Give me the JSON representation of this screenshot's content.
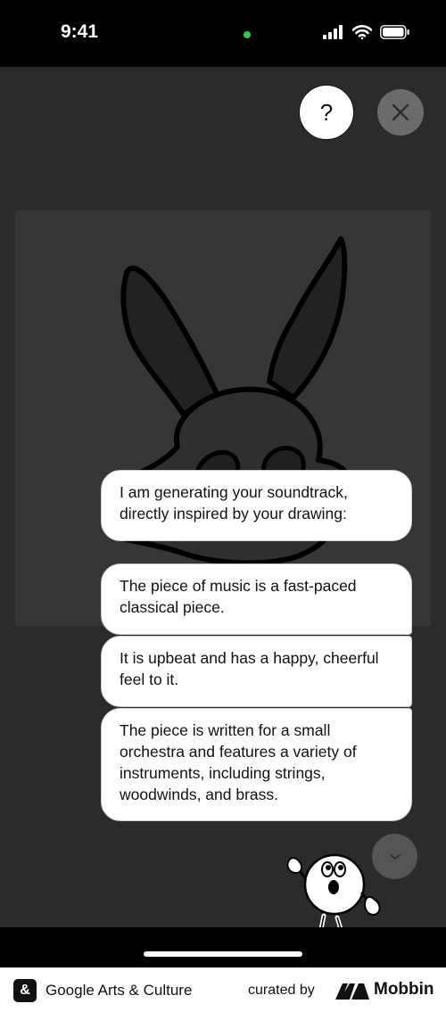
{
  "status_bar": {
    "time": "9:41",
    "camera_dot_color": "#2ecc40",
    "icons": [
      "cellular-signal-icon",
      "wifi-icon",
      "battery-icon"
    ]
  },
  "header": {
    "help_label": "?",
    "close_icon": "close-icon"
  },
  "messages": [
    {
      "text": "I am generating your soundtrack, directly inspired by your drawing:"
    },
    {
      "text": "The piece of music is a fast-paced classical piece."
    },
    {
      "text": "It is upbeat and has a happy, cheerful feel to it."
    },
    {
      "text": "The piece is written for a small orchestra and features a variety of instruments, including strings, woodwinds, and brass."
    }
  ],
  "footer": {
    "logo_glyph": "&",
    "app_name": "Google Arts & Culture",
    "curated_by": "curated by",
    "brand": "Mobbin"
  },
  "colors": {
    "background": "#2b2b2b",
    "canvas": "#363636",
    "bubble": "#ffffff",
    "close_button": "#6b6b6b"
  }
}
